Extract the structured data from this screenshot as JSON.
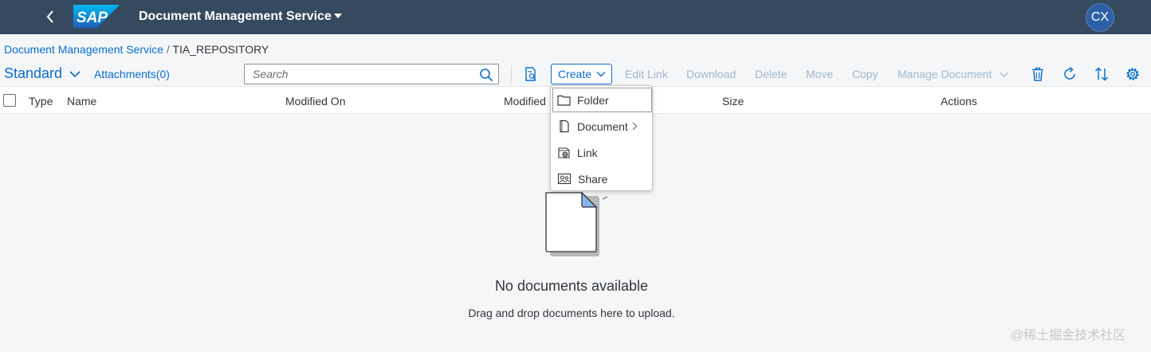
{
  "shell": {
    "logo_text": "SAP",
    "app_title": "Document Management Service",
    "avatar_initials": "CX"
  },
  "breadcrumb": {
    "link": "Document Management Service",
    "separator": "/",
    "current": "TIA_REPOSITORY"
  },
  "toolbar": {
    "variant": "Standard",
    "attachments": "Attachments(0)",
    "search_placeholder": "Search",
    "create": "Create",
    "edit_link": "Edit Link",
    "download": "Download",
    "delete": "Delete",
    "move": "Move",
    "copy": "Copy",
    "manage_document": "Manage Document"
  },
  "table": {
    "columns": [
      "Type",
      "Name",
      "Modified On",
      "Modified",
      "Size",
      "Actions"
    ]
  },
  "empty_state": {
    "title": "No documents available",
    "description": "Drag and drop documents here to upload."
  },
  "create_menu": {
    "items": [
      {
        "label": "Folder",
        "icon": "folder-icon"
      },
      {
        "label": "Document",
        "icon": "document-icon"
      },
      {
        "label": "Link",
        "icon": "link-icon"
      },
      {
        "label": "Share",
        "icon": "share-icon"
      }
    ]
  },
  "watermark": "@稀土掘金技术社区",
  "colors": {
    "shell_bg": "#354a5f",
    "accent": "#0a6ed1",
    "disabled": "#a0b7cd",
    "page_bg": "#f5f6f7"
  }
}
